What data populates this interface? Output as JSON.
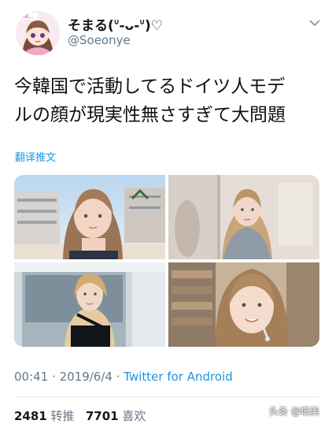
{
  "user": {
    "display_name": "そまる(ᐡ-ᴗ-ᐡ)♡",
    "handle": "@Soeonye",
    "avatar_badge": "ahiE..."
  },
  "tweet": {
    "text_line1": "今韓国で活動してるドイツ人モデ",
    "text_line2": "ルの顔が現実性無さすぎて大問題",
    "translate_label": "翻译推文"
  },
  "media": {
    "photos": [
      {
        "label": "photo-1"
      },
      {
        "label": "photo-2"
      },
      {
        "label": "photo-3"
      },
      {
        "label": "photo-4"
      }
    ]
  },
  "meta": {
    "time": "00:41",
    "separator": "·",
    "date": "2019/6/4",
    "source": "Twitter for Android"
  },
  "stats": {
    "retweets_count": "2481",
    "retweets_label": "转推",
    "likes_count": "7701",
    "likes_label": "喜欢"
  },
  "watermark": {
    "text": "头条 @填美"
  },
  "colors": {
    "link": "#1b95e0",
    "secondary_text": "#657786",
    "divider": "#e6ecf0"
  }
}
